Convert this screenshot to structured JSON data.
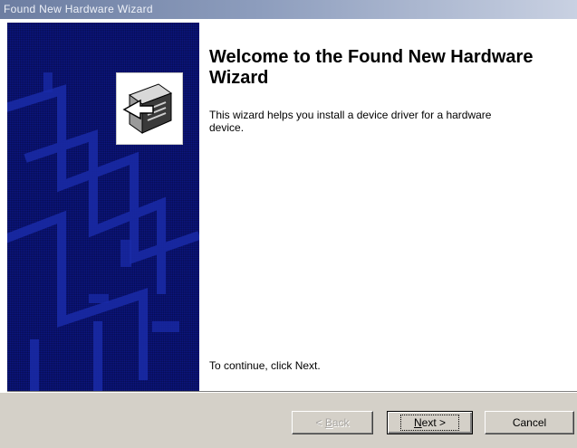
{
  "window": {
    "title": "Found New Hardware Wizard"
  },
  "content": {
    "heading": "Welcome to the Found New Hardware Wizard",
    "description": "This wizard helps you install a device driver for a hardware device.",
    "continue_text": "To continue, click Next."
  },
  "buttons": {
    "back": {
      "prefix": "< ",
      "mnemonic": "B",
      "rest": "ack"
    },
    "next": {
      "mnemonic": "N",
      "rest": "ext >"
    },
    "cancel": {
      "label": "Cancel"
    }
  },
  "colors": {
    "title_bar": "#6c7da1",
    "art_panel": "#0b1580",
    "dialog_face": "#d4d0c8"
  },
  "icons": {
    "banner": "wizard-hardware-icon"
  }
}
